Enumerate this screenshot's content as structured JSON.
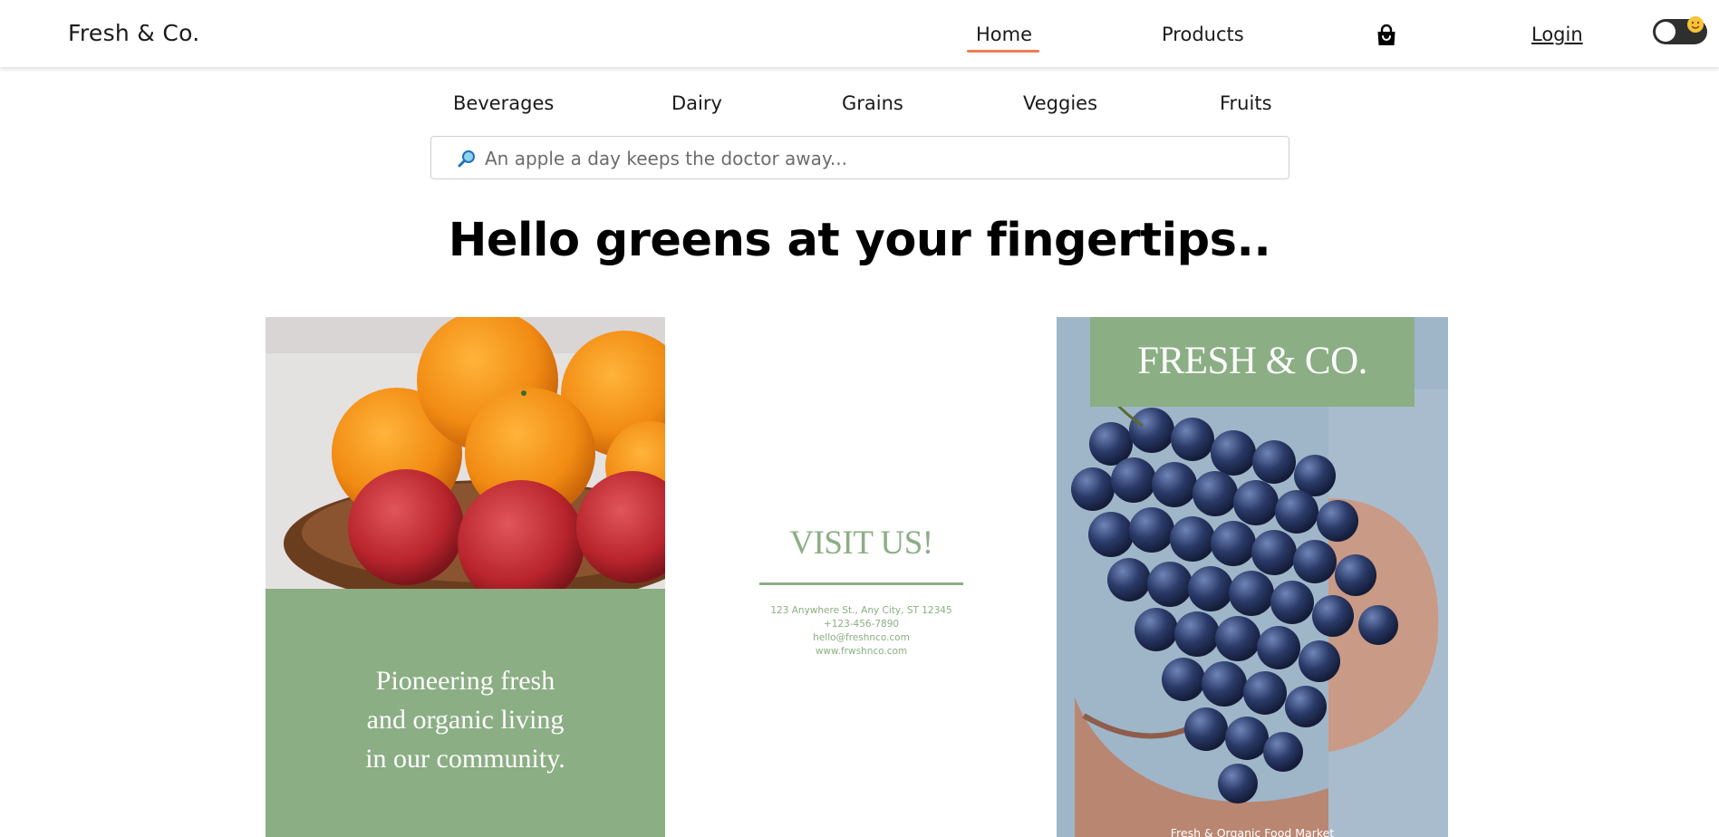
{
  "header": {
    "brand": "Fresh & Co.",
    "nav": {
      "home": "Home",
      "products": "Products",
      "login": "Login"
    },
    "icons": {
      "cart": "shopping-bag-icon",
      "theme": "theme-toggle-emoji-icon"
    },
    "accent_color": "#f07c52"
  },
  "categories": [
    "Beverages",
    "Dairy",
    "Grains",
    "Veggies",
    "Fruits"
  ],
  "search": {
    "icon": "magnifying-glass-icon",
    "placeholder": "An apple a day keeps the doctor away..."
  },
  "hero": {
    "title": "Hello greens at your fingertips.."
  },
  "flyer": {
    "green": "#8bae84",
    "left": {
      "tagline_lines": [
        "Pioneering fresh",
        "and organic living",
        "in our community."
      ]
    },
    "middle": {
      "title": "VISIT US!",
      "contact": [
        "123 Anywhere St., Any City, ST 12345",
        "+123-456-7890",
        "hello@freshnco.com",
        "www.frwshnco.com"
      ]
    },
    "right": {
      "brand": "FRESH & CO.",
      "caption": "Fresh & Organic Food Market"
    }
  }
}
